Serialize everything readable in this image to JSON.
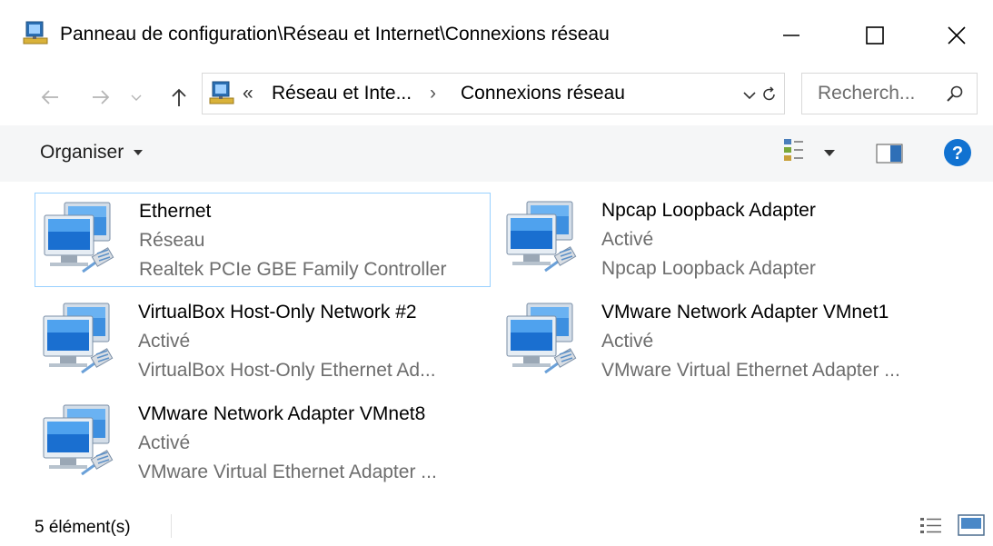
{
  "window": {
    "title": "Panneau de configuration\\Réseau et Internet\\Connexions réseau",
    "icon": "network-connections-icon"
  },
  "address": {
    "overflow": "«",
    "crumbs": [
      "Réseau et Inte...",
      "Connexions réseau"
    ],
    "separator": "›"
  },
  "search": {
    "placeholder": "Recherch..."
  },
  "toolbar": {
    "organize_label": "Organiser"
  },
  "items": [
    {
      "name": "Ethernet",
      "status": "Réseau",
      "device": "Realtek PCIe GBE Family Controller",
      "selected": true
    },
    {
      "name": "Npcap Loopback Adapter",
      "status": "Activé",
      "device": "Npcap Loopback Adapter"
    },
    {
      "name": "VirtualBox Host-Only Network #2",
      "status": "Activé",
      "device": "VirtualBox Host-Only Ethernet Ad..."
    },
    {
      "name": "VMware Network Adapter VMnet1",
      "status": "Activé",
      "device": "VMware Virtual Ethernet Adapter ..."
    },
    {
      "name": "VMware Network Adapter VMnet8",
      "status": "Activé",
      "device": "VMware Virtual Ethernet Adapter ..."
    }
  ],
  "statusbar": {
    "count": "5 élément(s)"
  },
  "colors": {
    "accent": "#0078d7",
    "selection_border": "#99d1ff",
    "toolbar_bg": "#f5f6f7",
    "muted_text": "#6d6d6d"
  }
}
